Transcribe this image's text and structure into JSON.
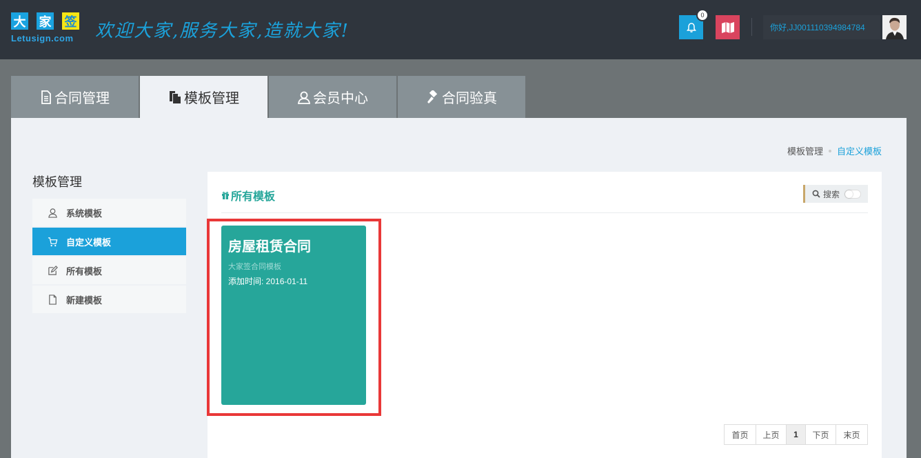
{
  "logo": {
    "chars": [
      "大",
      "家",
      "签"
    ],
    "sub": "Letusign.com"
  },
  "slogan": "欢迎大家,服务大家,造就大家!",
  "notifications": {
    "count": "0"
  },
  "user": {
    "greeting": "你好,JJ001110394984784"
  },
  "tabs": [
    {
      "label": "合同管理",
      "icon": "document-icon"
    },
    {
      "label": "模板管理",
      "icon": "copy-icon"
    },
    {
      "label": "会员中心",
      "icon": "user-icon"
    },
    {
      "label": "合同验真",
      "icon": "gavel-icon"
    }
  ],
  "breadcrumb": {
    "parent": "模板管理",
    "current": "自定义模板"
  },
  "sidebar": {
    "title": "模板管理",
    "items": [
      {
        "label": "系统模板",
        "icon": "user-icon"
      },
      {
        "label": "自定义模板",
        "icon": "cart-icon"
      },
      {
        "label": "所有模板",
        "icon": "edit-icon"
      },
      {
        "label": "新建模板",
        "icon": "file-icon"
      }
    ]
  },
  "panel": {
    "title": "所有模板",
    "search_label": "搜索"
  },
  "card": {
    "title": "房屋租赁合同",
    "subtitle": "大家签合同模板",
    "date": "添加时间: 2016-01-11"
  },
  "pager": {
    "first": "首页",
    "prev": "上页",
    "current": "1",
    "next": "下页",
    "last": "末页"
  },
  "colors": {
    "accent": "#1ba1da",
    "teal": "#26a69a",
    "highlight": "#e93838",
    "header": "#2f353d"
  }
}
